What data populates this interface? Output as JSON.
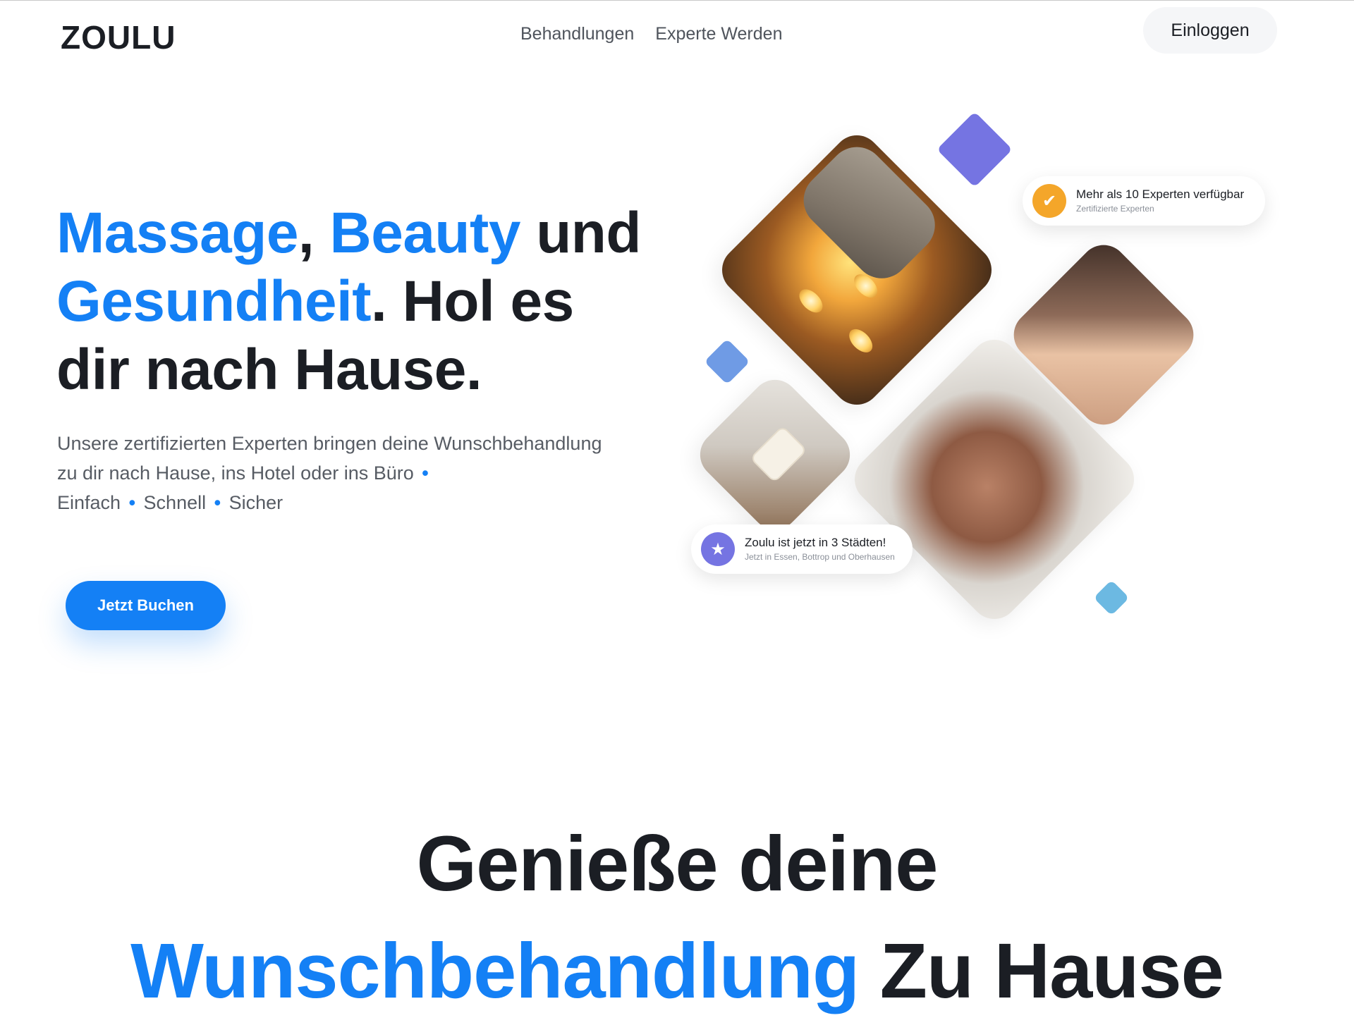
{
  "header": {
    "logo": "ZOULU",
    "nav": [
      {
        "label": "Behandlungen"
      },
      {
        "label": "Experte Werden"
      }
    ],
    "login_label": "Einloggen"
  },
  "hero": {
    "title": {
      "w1": "Massage",
      "sep1": ", ",
      "w2": "Beauty",
      "w3": " und ",
      "w4": "Gesundheit",
      "w5": ". Hol es dir nach Hause."
    },
    "subtitle": {
      "line1": "Unsere zertifizierten Experten bringen deine Wunschbehandlung zu dir nach Hause, ins Hotel oder ins Büro",
      "dot": "•",
      "item1": "Einfach",
      "item2": "Schnell",
      "item3": "Sicher"
    },
    "cta_label": "Jetzt Buchen",
    "badges": {
      "experts": {
        "title": "Mehr als 10 Experten verfügbar",
        "subtitle": "Zertifizierte Experten",
        "icon": "check-badge-icon"
      },
      "cities": {
        "title": "Zoulu ist jetzt in 3 Städten!",
        "subtitle": "Jetzt in Essen, Bottrop und Oberhausen",
        "icon": "star-icon"
      }
    }
  },
  "section2": {
    "line1": "Genieße deine",
    "highlight": "Wunschbehandlung",
    "rest": " Zu Hause"
  },
  "colors": {
    "accent": "#1480f5",
    "text": "#1b1e24",
    "deco_purple": "#7574e2",
    "badge_orange": "#f4a62a"
  }
}
